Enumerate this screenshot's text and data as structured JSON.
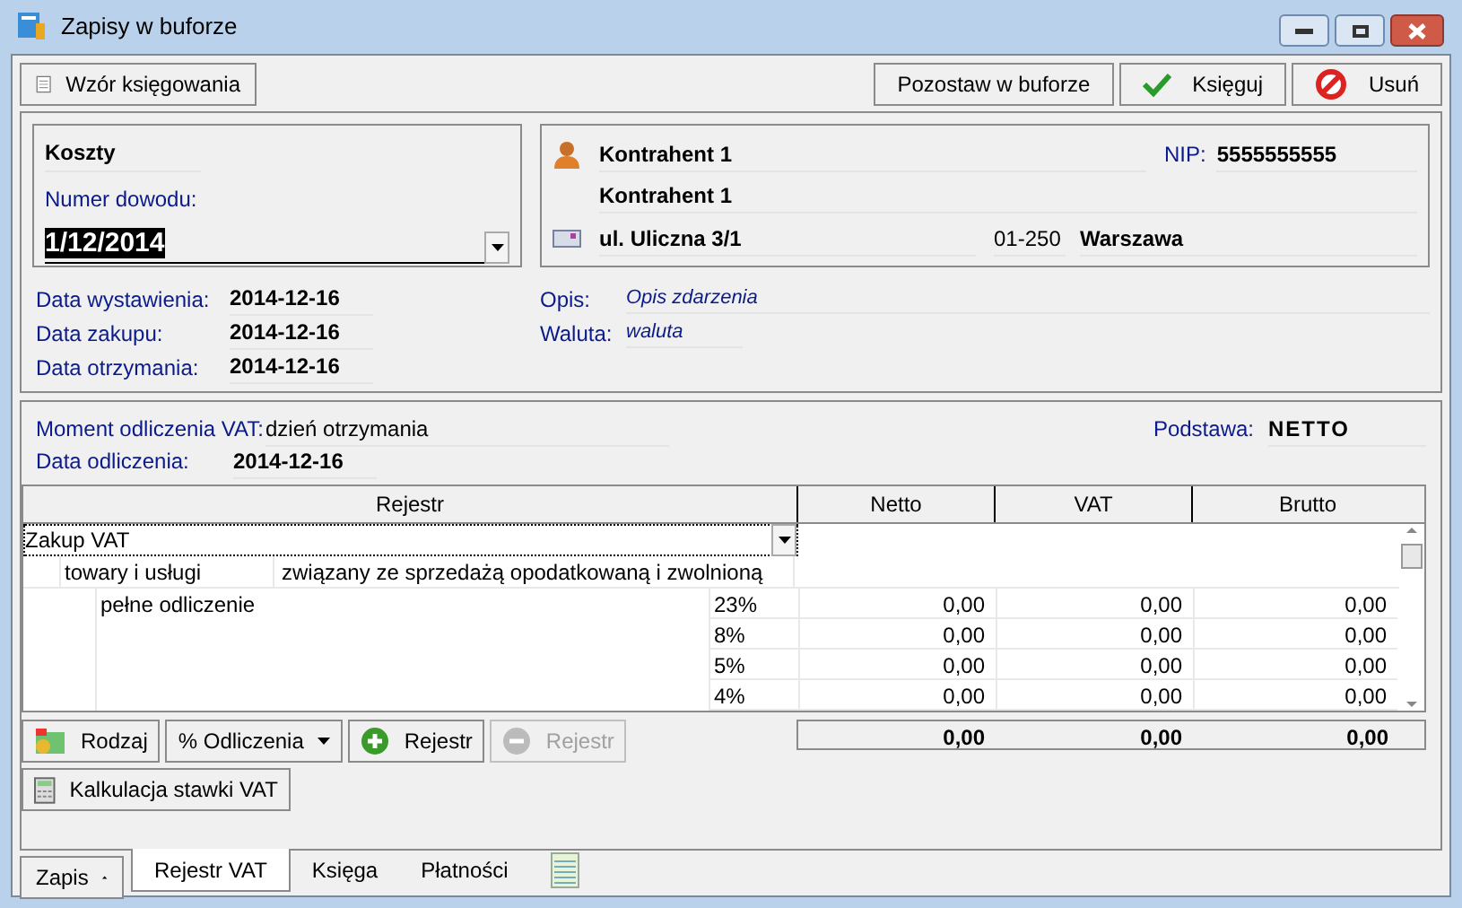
{
  "window": {
    "title": "Zapisy w buforze"
  },
  "toolbar": {
    "left": [
      {
        "label": "Wzór księgowania",
        "disabled": false
      }
    ],
    "right": [
      {
        "label": "Pozostaw w buforze",
        "kind": "plain"
      },
      {
        "label": "Księguj",
        "kind": "check"
      },
      {
        "label": "Usuń",
        "kind": "delete"
      }
    ]
  },
  "document": {
    "type": "Koszty",
    "number_label": "Numer dowodu:",
    "number_value": "1/12/2014"
  },
  "contractor": {
    "name": "Kontrahent 1",
    "nip_label": "NIP:",
    "nip": "5555555555",
    "name2": "Kontrahent 1",
    "street": "ul. Uliczna 3/1",
    "postcode": "01-250",
    "city": "Warszawa"
  },
  "dates": [
    {
      "label": "Data wystawienia:",
      "value": "2014-12-16"
    },
    {
      "label": "Data zakupu:",
      "value": "2014-12-16"
    },
    {
      "label": "Data otrzymania:",
      "value": "2014-12-16"
    }
  ],
  "details": [
    {
      "label": "Opis:",
      "value": "Opis zdarzenia"
    },
    {
      "label": "Waluta:",
      "value": "waluta"
    }
  ],
  "vat": {
    "moment_label": "Moment odliczenia VAT:",
    "moment_value": "dzień otrzymania",
    "date_label": "Data odliczenia:",
    "date_value": "2014-12-16",
    "basis_label": "Podstawa:",
    "basis_value": "NETTO"
  },
  "table": {
    "columns": [
      "Rejestr",
      "Netto",
      "VAT",
      "Brutto"
    ],
    "register": "Zakup VAT",
    "type": "towary i usługi",
    "purpose": "związany ze sprzedażą opodatkowaną i zwolnioną",
    "deduction": "pełne odliczenie",
    "rows": [
      {
        "rate": "23%",
        "netto": "0,00",
        "vat": "0,00",
        "brutto": "0,00"
      },
      {
        "rate": "8%",
        "netto": "0,00",
        "vat": "0,00",
        "brutto": "0,00"
      },
      {
        "rate": "5%",
        "netto": "0,00",
        "vat": "0,00",
        "brutto": "0,00"
      },
      {
        "rate": "4%",
        "netto": "0,00",
        "vat": "0,00",
        "brutto": "0,00"
      }
    ],
    "totals": {
      "netto": "0,00",
      "vat": "0,00",
      "brutto": "0,00"
    }
  },
  "actions": [
    {
      "label": "Rodzaj",
      "kind": "folder",
      "disabled": false
    },
    {
      "label": "% Odliczenia",
      "kind": "menu",
      "disabled": false
    },
    {
      "label": "Rejestr",
      "kind": "add",
      "disabled": false
    },
    {
      "label": "Rejestr",
      "kind": "remove",
      "disabled": true
    }
  ],
  "calc_button": {
    "label": "Kalkulacja stawki VAT"
  },
  "bottom_tabs": {
    "menu_button": "Zapis",
    "tabs": [
      {
        "label": "Rejestr VAT",
        "selected": true
      },
      {
        "label": "Księga",
        "selected": false
      },
      {
        "label": "Płatności",
        "selected": false
      },
      {
        "kind": "notes",
        "selected": false
      }
    ]
  }
}
